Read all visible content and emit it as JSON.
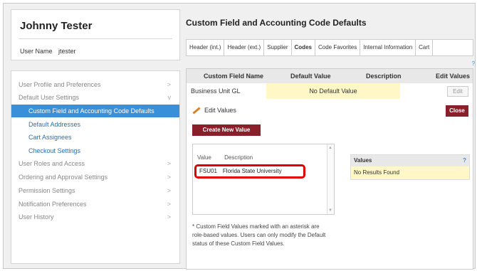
{
  "user": {
    "full_name": "Johnny Tester",
    "username_label": "User Name",
    "username_value": "jtester"
  },
  "nav": {
    "items": [
      {
        "label": "User Profile and Preferences",
        "chevron": ">"
      },
      {
        "label": "Default User Settings",
        "chevron": "v"
      },
      {
        "label": "Custom Field and Accounting Code Defaults"
      },
      {
        "label": "Default Addresses"
      },
      {
        "label": "Cart Assignees"
      },
      {
        "label": "Checkout Settings"
      },
      {
        "label": "User Roles and Access",
        "chevron": ">"
      },
      {
        "label": "Ordering and Approval Settings",
        "chevron": ">"
      },
      {
        "label": "Permission Settings",
        "chevron": ">"
      },
      {
        "label": "Notification Preferences",
        "chevron": ">"
      },
      {
        "label": "User History",
        "chevron": ">"
      }
    ]
  },
  "page": {
    "title": "Custom Field and Accounting Code Defaults",
    "help": "?"
  },
  "tabs": [
    {
      "label": "Header (int.)"
    },
    {
      "label": "Header (ext.)"
    },
    {
      "label": "Supplier"
    },
    {
      "label": "Codes"
    },
    {
      "label": "Code Favorites"
    },
    {
      "label": "Internal Information"
    },
    {
      "label": "Cart"
    }
  ],
  "table": {
    "headers": {
      "name": "Custom Field Name",
      "default": "Default Value",
      "description": "Description",
      "edit": "Edit Values"
    },
    "row": {
      "name": "Business Unit GL",
      "default": "No Default Value",
      "edit": "Edit"
    }
  },
  "editor": {
    "edit_values_label": "Edit Values",
    "close_label": "Close",
    "create_label": "Create New Value",
    "list_headers": {
      "value": "Value",
      "description": "Description"
    },
    "list_items": [
      {
        "value": "FSU01",
        "description": "Florida State University"
      }
    ],
    "values_panel": {
      "title": "Values",
      "help": "?",
      "empty": "No Results Found"
    },
    "note": "* Custom Field Values marked with an asterisk are role-based values. Users can only modify the Default status of these Custom Field Values."
  },
  "colors": {
    "accent": "#3a8fd9",
    "brand": "#8a1f2b",
    "highlight": "#fff8c6",
    "callout": "#e00000"
  }
}
